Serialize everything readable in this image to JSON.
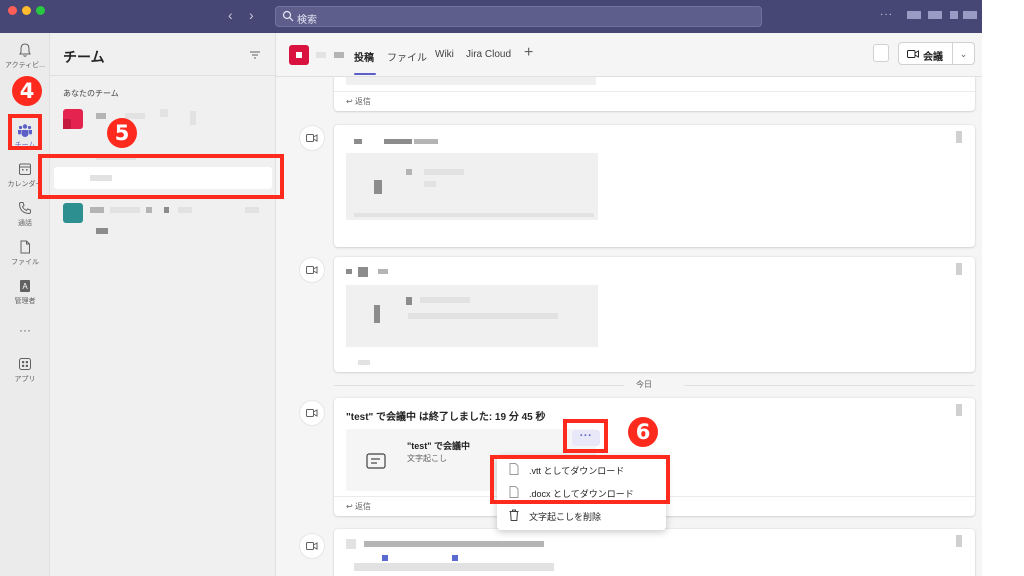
{
  "search": {
    "placeholder": "検索",
    "icon": "search-icon"
  },
  "rail": {
    "items": [
      {
        "label": "アクティビ...",
        "icon": "bell-icon"
      },
      {
        "label": "チーム",
        "icon": "teams-icon"
      },
      {
        "label": "カレンダー",
        "icon": "calendar-icon"
      },
      {
        "label": "通話",
        "icon": "phone-icon"
      },
      {
        "label": "ファイル",
        "icon": "file-icon"
      },
      {
        "label": "管理者",
        "icon": "admin-icon"
      },
      {
        "label": "アプリ",
        "icon": "apps-icon"
      }
    ],
    "more": "···"
  },
  "teams_panel": {
    "title": "チーム",
    "section_label": "あなたのチーム"
  },
  "channel": {
    "tabs": [
      "投稿",
      "ファイル",
      "Wiki",
      "Jira Cloud"
    ],
    "meet_label": "会議"
  },
  "feed": {
    "reply_label": "返信",
    "date_separator": "今日",
    "meeting_post": {
      "title": "\"test\" で会議中 は終了しました: 19 分 45 秒",
      "card_title": "\"test\" で会議中",
      "card_subtitle": "文字起こし",
      "more_label": "···"
    }
  },
  "context_menu": {
    "items": [
      {
        "label": ".vtt としてダウンロード",
        "icon": "document-icon"
      },
      {
        "label": ".docx としてダウンロード",
        "icon": "document-icon"
      },
      {
        "label": "文字起こしを削除",
        "icon": "trash-icon"
      }
    ]
  },
  "annotations": {
    "badges": [
      "4",
      "5",
      "6"
    ],
    "color": "#ff2a1e"
  },
  "colors": {
    "titlebar": "#464775",
    "accent": "#5b5fc7",
    "channel_avatar": "#d9123f"
  }
}
